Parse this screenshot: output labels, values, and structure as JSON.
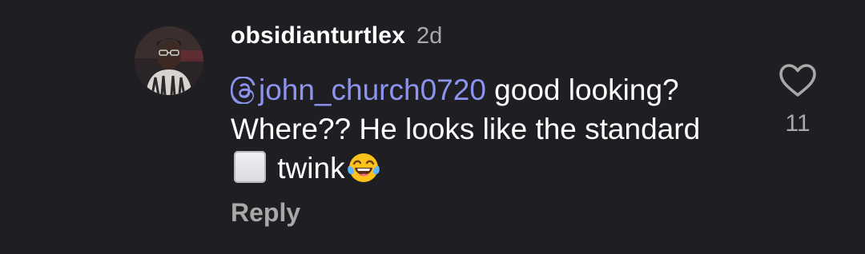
{
  "comment": {
    "username": "obsidianturtlex",
    "time": "2d",
    "mention": "john_church0720",
    "text_after_mention": " good looking? Where?? He looks like the standard",
    "text_after_square": " twink",
    "reply_label": "Reply",
    "like_count": "11",
    "icons": {
      "mention": "threads-at-icon",
      "like": "heart-outline-icon",
      "emoji_1": "white-square-emoji",
      "emoji_2": "face-with-tears-of-joy-emoji"
    },
    "colors": {
      "background": "#1f1f23",
      "mention": "#8c94f0",
      "secondary_text": "#a8a8a8"
    }
  }
}
